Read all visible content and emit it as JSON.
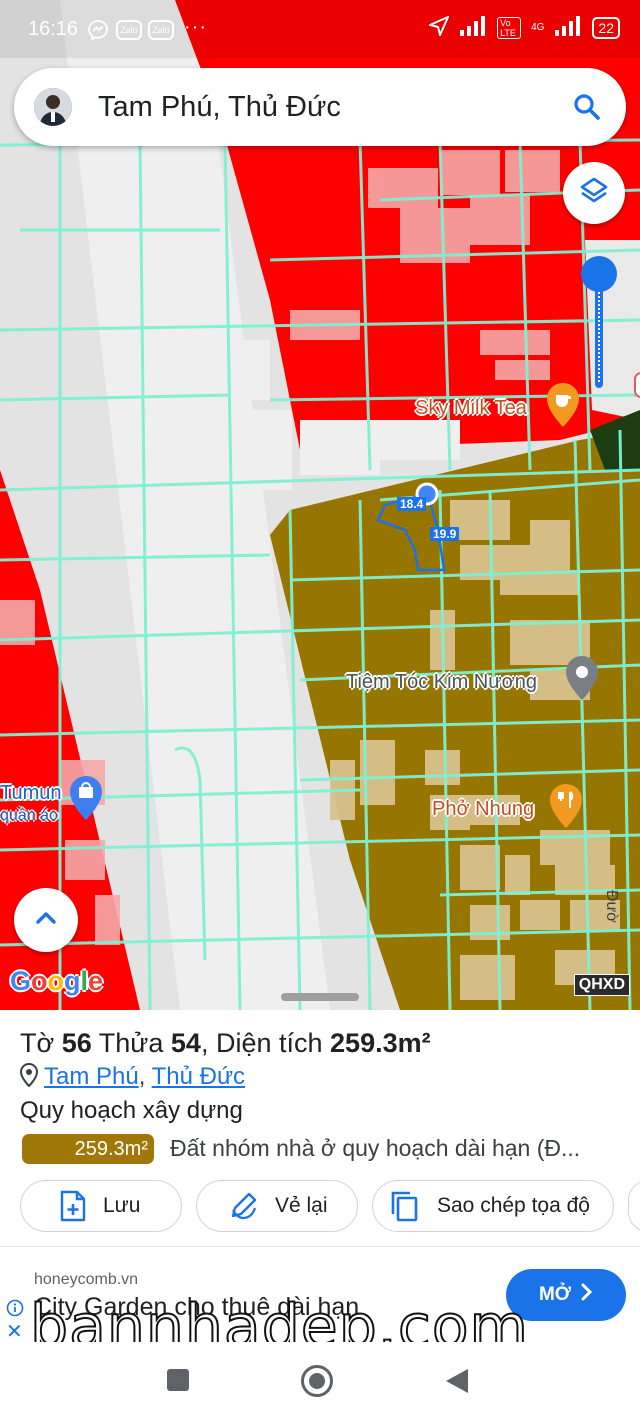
{
  "status_bar": {
    "time": "16:16",
    "notifications": [
      "messenger-icon",
      "zalo-icon",
      "zalo-icon",
      "more-dots"
    ],
    "zalo_label": "Zalo",
    "network": "4G",
    "volte": "Vo LTE",
    "battery": "22"
  },
  "search": {
    "title": "Tam Phú, Thủ Đức"
  },
  "map": {
    "pois": {
      "milk_tea": "Sky Milk Tea",
      "hair_salon": "Tiệm Tóc Kim Nương",
      "pho": "Phở Nhung",
      "shop": "Tumun",
      "shop_sub": "quần áo",
      "street_edge": "Đườ"
    },
    "measurements": [
      "18.4",
      "19.9"
    ],
    "provider": "Google",
    "layer_badge": "QHXD",
    "colors": {
      "residential_red": "#ff0000",
      "planning_brown": "#967500",
      "parcel_lines": "#7ff0d2",
      "background": "#e3e3e3"
    }
  },
  "sheet": {
    "to_label": "Tờ",
    "to_value": "56",
    "thua_label": "Thửa",
    "thua_value": "54",
    "area_label": ", Diện tích",
    "area_value": "259.3m²",
    "location_ward": "Tam Phú",
    "location_sep": ",",
    "location_district": "Thủ Đức",
    "zone_title": "Quy hoạch xây dựng",
    "zone_area": "259.3m²",
    "zone_desc": "Đất nhóm nhà ở quy hoạch dài hạn (Đ...",
    "actions": {
      "save": "Lưu",
      "redraw": "Vẻ lại",
      "copy_coords": "Sao chép tọa độ"
    }
  },
  "ad": {
    "domain": "honeycomb.vn",
    "headline": "City Garden cho thuê dài hạn",
    "open": "MỞ"
  },
  "watermark": "bannhadep.com"
}
